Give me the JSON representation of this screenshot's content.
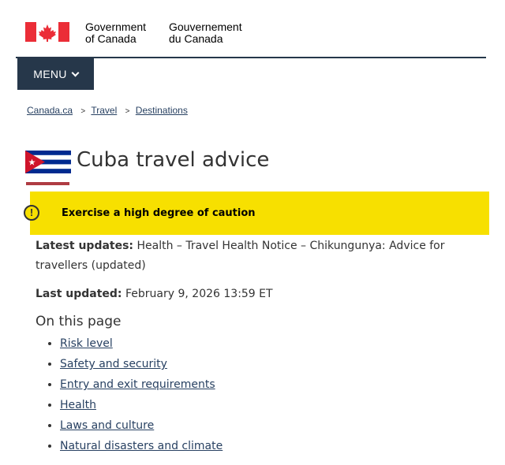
{
  "header": {
    "signature_en_line1": "Government",
    "signature_en_line2": "of Canada",
    "signature_fr_line1": "Gouvernement",
    "signature_fr_line2": "du Canada",
    "flag_color": "#eb2d37"
  },
  "menu": {
    "label": "MENU",
    "icon": "chevron-down-icon",
    "bg_color": "#26374a"
  },
  "breadcrumb": [
    "Canada.ca",
    "Travel",
    "Destinations"
  ],
  "page": {
    "title": "Cuba travel advice",
    "flag": "cuba-flag",
    "title_underline_color": "#af3c43"
  },
  "advisory": {
    "level_text": "Exercise a high degree of caution",
    "icon": "exclamation-icon",
    "bg_color": "#f7e000"
  },
  "latest_updates": {
    "label": "Latest updates:",
    "value": "Health – Travel Health Notice – Chikungunya: Advice for travellers (updated)"
  },
  "last_updated": {
    "label": "Last updated:",
    "value": "February 9, 2026 13:59 ET"
  },
  "on_this_page": {
    "heading": "On this page",
    "items": [
      "Risk level",
      "Safety and security",
      "Entry and exit requirements",
      "Health",
      "Laws and culture",
      "Natural disasters and climate"
    ]
  }
}
